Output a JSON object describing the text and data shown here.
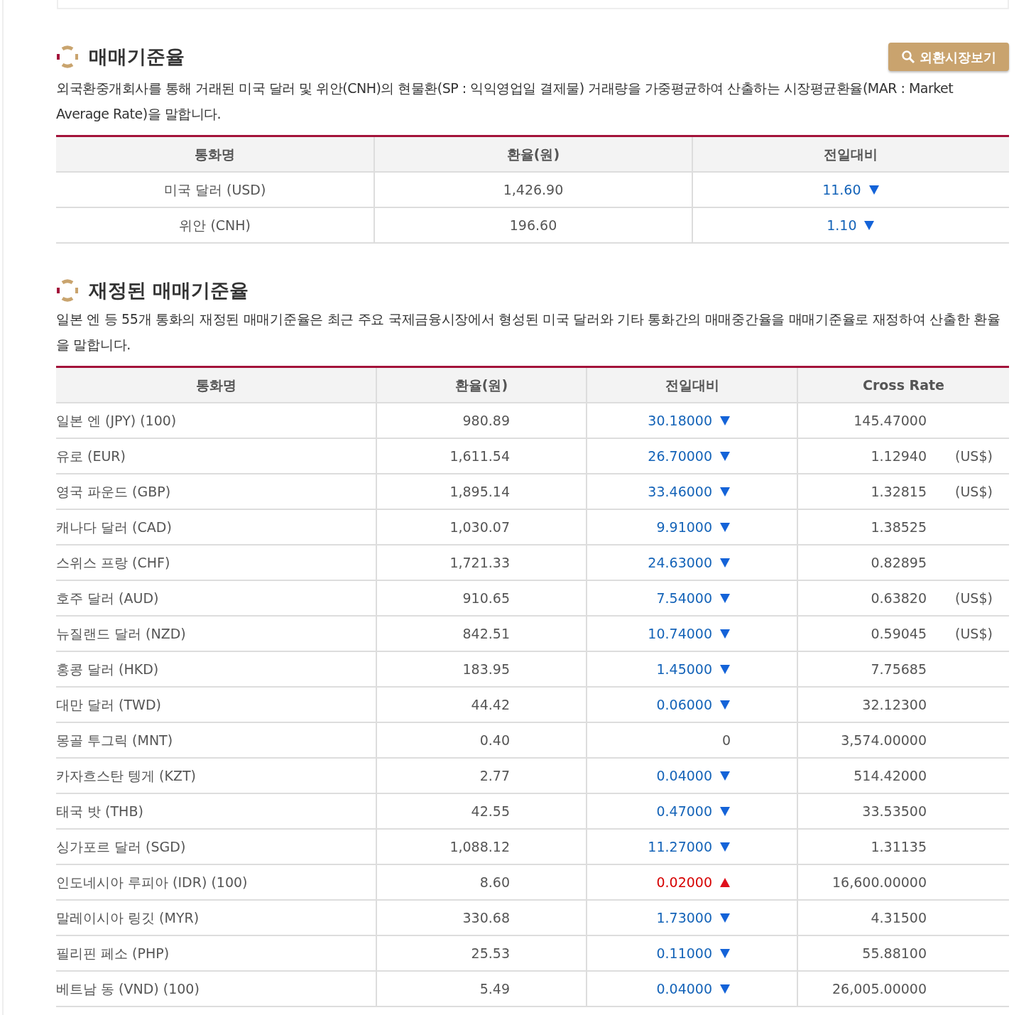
{
  "section1": {
    "title": "매매기준율",
    "button": "외환시장보기",
    "description": "외국환중개회사를 통해 거래된 미국 달러 및 위안(CNH)의 현물환(SP : 익익영업일 결제물) 거래량을 가중평균하여 산출하는 시장평균환율(MAR : Market Average Rate)을 말합니다.",
    "columns": [
      "통화명",
      "환율(원)",
      "전일대비"
    ],
    "rows": [
      {
        "name": "미국 달러 (USD)",
        "rate": "1,426.90",
        "change": "11.60",
        "kind": "down"
      },
      {
        "name": "위안 (CNH)",
        "rate": "196.60",
        "change": "1.10",
        "kind": "down"
      }
    ]
  },
  "section2": {
    "title": "재정된 매매기준율",
    "description": "일본 엔 등 55개 통화의 재정된 매매기준율은 최근 주요 국제금융시장에서 형성된 미국 달러와 기타 통화간의 매매중간율을 매매기준율로 재정하여 산출한 환율을 말합니다.",
    "columns": [
      "통화명",
      "환율(원)",
      "전일대비",
      "Cross Rate"
    ],
    "rows": [
      {
        "name": "일본 엔 (JPY) (100)",
        "rate": "980.89",
        "change": "30.18000",
        "kind": "down",
        "cross": "145.47000"
      },
      {
        "name": "유로 (EUR)",
        "rate": "1,611.54",
        "change": "26.70000",
        "kind": "down",
        "cross": "1.12940",
        "unit": "(US$)"
      },
      {
        "name": "영국 파운드 (GBP)",
        "rate": "1,895.14",
        "change": "33.46000",
        "kind": "down",
        "cross": "1.32815",
        "unit": "(US$)"
      },
      {
        "name": "캐나다 달러 (CAD)",
        "rate": "1,030.07",
        "change": "9.91000",
        "kind": "down",
        "cross": "1.38525"
      },
      {
        "name": "스위스 프랑 (CHF)",
        "rate": "1,721.33",
        "change": "24.63000",
        "kind": "down",
        "cross": "0.82895"
      },
      {
        "name": "호주 달러 (AUD)",
        "rate": "910.65",
        "change": "7.54000",
        "kind": "down",
        "cross": "0.63820",
        "unit": "(US$)"
      },
      {
        "name": "뉴질랜드 달러 (NZD)",
        "rate": "842.51",
        "change": "10.74000",
        "kind": "down",
        "cross": "0.59045",
        "unit": "(US$)"
      },
      {
        "name": "홍콩 달러 (HKD)",
        "rate": "183.95",
        "change": "1.45000",
        "kind": "down",
        "cross": "7.75685"
      },
      {
        "name": "대만 달러 (TWD)",
        "rate": "44.42",
        "change": "0.06000",
        "kind": "down",
        "cross": "32.12300"
      },
      {
        "name": "몽골 투그릭 (MNT)",
        "rate": "0.40",
        "change": "0",
        "kind": "flat",
        "cross": "3,574.00000"
      },
      {
        "name": "카자흐스탄 텡게 (KZT)",
        "rate": "2.77",
        "change": "0.04000",
        "kind": "down",
        "cross": "514.42000"
      },
      {
        "name": "태국 밧 (THB)",
        "rate": "42.55",
        "change": "0.47000",
        "kind": "down",
        "cross": "33.53500"
      },
      {
        "name": "싱가포르 달러 (SGD)",
        "rate": "1,088.12",
        "change": "11.27000",
        "kind": "down",
        "cross": "1.31135"
      },
      {
        "name": "인도네시아 루피아 (IDR) (100)",
        "rate": "8.60",
        "change": "0.02000",
        "kind": "up",
        "cross": "16,600.00000"
      },
      {
        "name": "말레이시아 링깃 (MYR)",
        "rate": "330.68",
        "change": "1.73000",
        "kind": "down",
        "cross": "4.31500"
      },
      {
        "name": "필리핀 페소 (PHP)",
        "rate": "25.53",
        "change": "0.11000",
        "kind": "down",
        "cross": "55.88100"
      },
      {
        "name": "베트남 동 (VND) (100)",
        "rate": "5.49",
        "change": "0.04000",
        "kind": "down",
        "cross": "26,005.00000"
      }
    ]
  }
}
